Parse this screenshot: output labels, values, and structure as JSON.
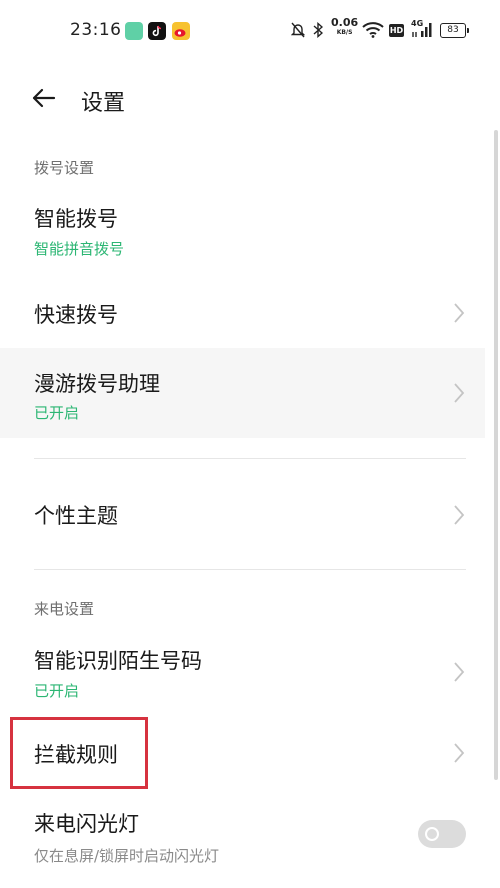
{
  "status_bar": {
    "time": "23:16",
    "net_speed": "0.06",
    "net_unit": "KB/S",
    "hd_label": "HD",
    "signal_label": "4G",
    "battery": "83"
  },
  "header": {
    "title": "设置"
  },
  "sections": {
    "dial_title": "拨号设置",
    "incoming_title": "来电设置"
  },
  "rows": {
    "smart_dial": {
      "title": "智能拨号",
      "subtitle": "智能拼音拨号"
    },
    "speed_dial": {
      "title": "快速拨号"
    },
    "roaming": {
      "title": "漫游拨号助理",
      "subtitle": "已开启"
    },
    "theme": {
      "title": "个性主题"
    },
    "identify": {
      "title": "智能识别陌生号码",
      "subtitle": "已开启"
    },
    "block": {
      "title": "拦截规则"
    },
    "flash": {
      "title": "来电闪光灯",
      "subtitle": "仅在息屏/锁屏时启动闪光灯",
      "enabled": false
    }
  },
  "colors": {
    "accent_green": "#2bb673",
    "highlight_red": "#d6323f",
    "roaming_bg": "#f6f6f6"
  }
}
